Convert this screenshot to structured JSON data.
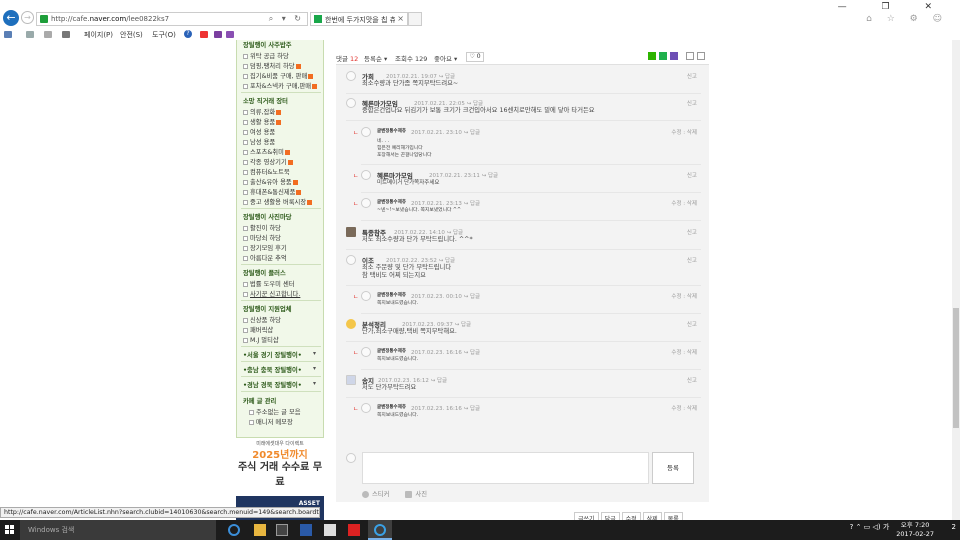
{
  "browser": {
    "url_prefix": "http://cafe.",
    "url_host": "naver.com",
    "url_path": "/lee0822ks7",
    "tab_title": "한번에 두가지맛을 칩 츄러...",
    "tab_close": "×",
    "url_tools": "⌕ ▾ ↻",
    "win_controls": "— ❐ ✕",
    "right_icons": "⌂ ☆ ⚙ ☺",
    "back_glyph": "←",
    "fwd_glyph": "→"
  },
  "command_bar": {
    "page_menu": "페이지(P)",
    "safety_menu": "안전(S)",
    "tools_menu": "도구(O)",
    "help_glyph": "?"
  },
  "sidebar": {
    "top_head": "장틸행이 사주밥주",
    "group1": [
      "위탁 공급 하당",
      "덤핑,땡처리 하당",
      "집기&비품 구매, 판매",
      "포차&스넥카 구매,판매"
    ],
    "head2": "소망 직거래 장터",
    "group2": [
      "의류,잡화",
      "생활 용품",
      "여성 용품",
      "남성 용품",
      "스포츠&취미",
      "각종 영상기기",
      "컴퓨터&노트북",
      "출산&유아 용품",
      "휴대폰&통신제품",
      "중고 생활용 버룩시장"
    ],
    "head3": "장틸행이 사진마당",
    "group3": [
      "활진이 하당",
      "마당쇠 하당",
      "장기모임 후기",
      "아름다운 추억"
    ],
    "head4": "장틸행이 플러스",
    "group4": [
      "법률 도우미 센터",
      "사기꾼 신고합니다."
    ],
    "head5": "장틸행이 지원업체",
    "group5": [
      "신상품 하당",
      "패버릭샵",
      "M.J 멀티샵"
    ],
    "region_heads": [
      "•서울 경기 장틸행이•",
      "•충남 충북 장틸행이•",
      "•경남 경북 장틸행이•"
    ],
    "chev": "▾",
    "head6": "카페 글 관리",
    "group6": [
      "주소없는 글 모음",
      "매니저 메모장"
    ]
  },
  "ad": {
    "small": "미래에셋대우 다이렉트",
    "year": "2025년까지",
    "headline": "주식 거래 수수료 무료",
    "logo": "ASSET"
  },
  "comments_header": {
    "label": "댓글",
    "count": "12",
    "sort": "등록순 ▾",
    "views": "조회수 129",
    "likes": "좋아요 ▾",
    "like_count": "♡ 0"
  },
  "comments": [
    {
      "nick": "가희",
      "date": "2017.02.21. 19:07",
      "reply": "↪ 답글",
      "body": [
        "최소수량과 단가좀 쪽지부탁드려요~"
      ],
      "right": "신고"
    },
    {
      "nick": "혜른마가모임",
      "date": "2017.02.21. 22:05",
      "reply": "↪ 답글",
      "body": [
        "중합은건업나요 뒤김기가 보통 크기가 크건입아서요 16센치로만해도 밑에 닿아 타거든요"
      ],
      "right": "신고"
    },
    {
      "nick": "글벤정통수제츄",
      "date": "2017.02.21. 23:10",
      "reply": "↪ 답글",
      "body": [
        "네. . .",
        "힘은전 예리해가입니다",
        "포장해서는 끈걸나입당니다"
      ],
      "right": "수정 : 삭제"
    },
    {
      "nick": "혜른마가모임",
      "date": "2017.02.21. 23:11",
      "reply": "↪ 답글",
      "body": [
        "미트메이거 단가쪽자주세요"
      ],
      "right": "신고"
    },
    {
      "nick": "글벤정통수제츄",
      "date": "2017.02.21. 23:13",
      "reply": "↪ 답글",
      "body": [
        "~넨~!~보냈습니다. 쪽지보냈었니다 ^^"
      ],
      "right": "수정 : 삭제"
    },
    {
      "nick": "특종참주",
      "date": "2017.02.22. 14:10",
      "reply": "↪ 답글",
      "body": [
        "저도 최소수량과 단가 부탁드립니다. ^^*"
      ],
      "right": "신고"
    },
    {
      "nick": "이조",
      "date": "2017.02.22. 23:52",
      "reply": "↪ 답글",
      "body": [
        "최소 주문량 및 단가 부탁드립니다",
        "참 택비도 어찌 되는지요"
      ],
      "right": "신고"
    },
    {
      "nick": "글벤정통수제츄",
      "date": "2017.02.23. 00:10",
      "reply": "↪ 답글",
      "body": [
        "쪽지보내드렸습니다."
      ],
      "right": "수정 : 삭제"
    },
    {
      "nick": "분석정리",
      "date": "2017.02.23. 09:37",
      "reply": "↪ 답글",
      "body": [
        "단가,최소구매량,택비 쪽지부탁해요."
      ],
      "right": "신고"
    },
    {
      "nick": "글벤정통수제츄",
      "date": "2017.02.23. 16:16",
      "reply": "↪ 답글",
      "body": [
        "쪽지보내드렸습니다."
      ],
      "right": "수정 : 삭제"
    },
    {
      "nick": "송지",
      "date": "2017.02.23. 16:12",
      "reply": "↪ 답글",
      "body": [
        "저도 단가부탁드려요"
      ],
      "right": "신고"
    },
    {
      "nick": "글벤정통수제츄",
      "date": "2017.02.23. 16:16",
      "reply": "↪ 답글",
      "body": [
        "쪽지보내드렸습니다."
      ],
      "right": "수정 : 삭제"
    }
  ],
  "compose": {
    "submit": "등록",
    "sticker": "스티커",
    "photo": "사진"
  },
  "bottom_buttons": [
    "글쓰기",
    "답글",
    "수정",
    "삭제",
    "목록"
  ],
  "status_url": "http://cafe.naver.com/ArticleList.nhn?search.clubid=14010630&search.menuid=149&search.boardtype=L",
  "taskbar": {
    "search": "Windows 검색",
    "time": "오후 7:20",
    "date": "2017-02-27",
    "tray": "? ⌃ ▭ ◁) 가",
    "notif": "2"
  }
}
